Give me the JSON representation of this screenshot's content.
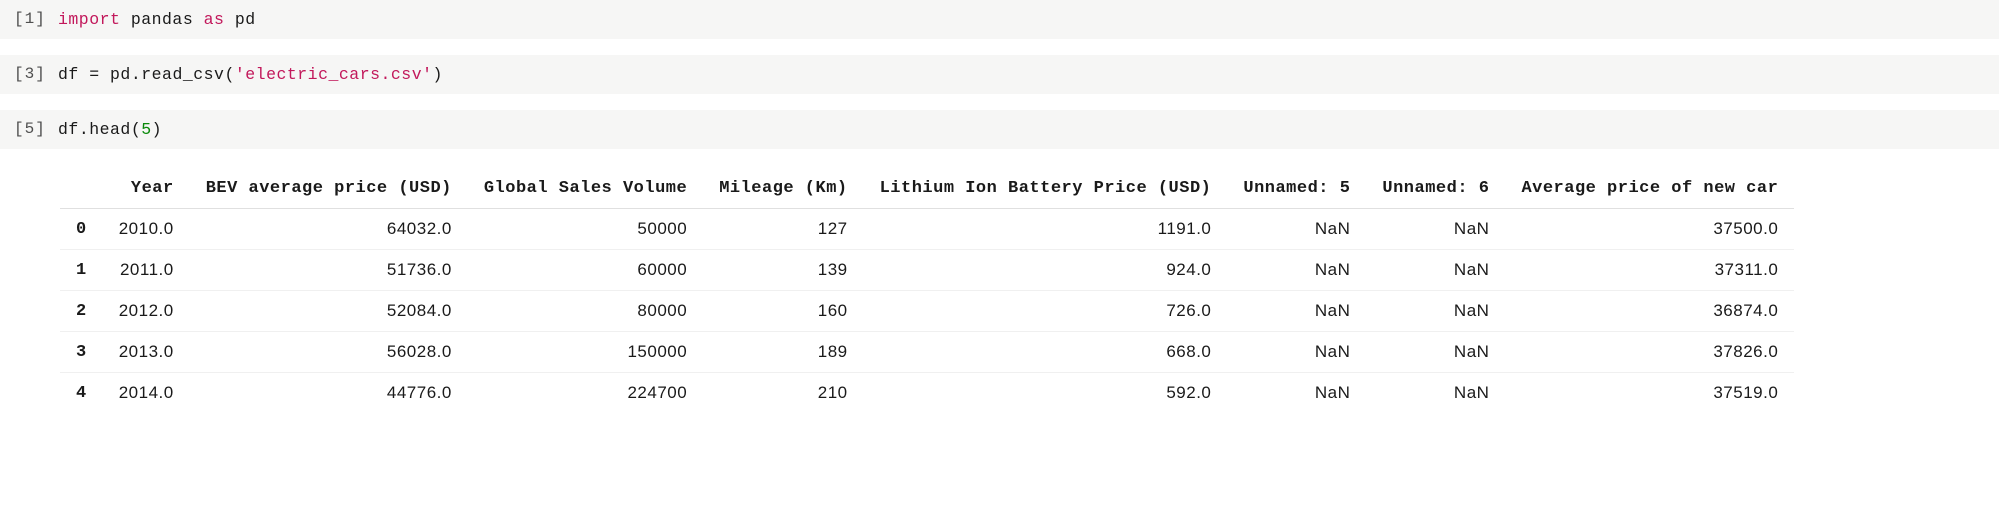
{
  "cells": [
    {
      "prompt": "[1]",
      "code_tokens": [
        {
          "t": "import ",
          "cls": "tok-str"
        },
        {
          "t": "pandas ",
          "cls": "tok-mod"
        },
        {
          "t": "as ",
          "cls": "tok-str"
        },
        {
          "t": "pd",
          "cls": "tok-mod"
        }
      ]
    },
    {
      "prompt": "[3]",
      "code_tokens": [
        {
          "t": "df ",
          "cls": "tok-var"
        },
        {
          "t": "= ",
          "cls": "tok-op"
        },
        {
          "t": "pd",
          "cls": "tok-var"
        },
        {
          "t": ".",
          "cls": "tok-op"
        },
        {
          "t": "read_csv",
          "cls": "tok-func"
        },
        {
          "t": "(",
          "cls": "tok-op"
        },
        {
          "t": "'electric_cars.csv'",
          "cls": "tok-str"
        },
        {
          "t": ")",
          "cls": "tok-op"
        }
      ]
    },
    {
      "prompt": "[5]",
      "code_tokens": [
        {
          "t": "df",
          "cls": "tok-var"
        },
        {
          "t": ".",
          "cls": "tok-op"
        },
        {
          "t": "head",
          "cls": "tok-func"
        },
        {
          "t": "(",
          "cls": "tok-op"
        },
        {
          "t": "5",
          "cls": "tok-num"
        },
        {
          "t": ")",
          "cls": "tok-op"
        }
      ]
    }
  ],
  "dataframe": {
    "columns": [
      "Year",
      "BEV average price (USD)",
      "Global Sales Volume",
      "Mileage (Km)",
      "Lithium Ion Battery Price (USD)",
      "Unnamed: 5",
      "Unnamed: 6",
      "Average price of new car"
    ],
    "index": [
      "0",
      "1",
      "2",
      "3",
      "4"
    ],
    "rows": [
      [
        "2010.0",
        "64032.0",
        "50000",
        "127",
        "1191.0",
        "NaN",
        "NaN",
        "37500.0"
      ],
      [
        "2011.0",
        "51736.0",
        "60000",
        "139",
        "924.0",
        "NaN",
        "NaN",
        "37311.0"
      ],
      [
        "2012.0",
        "52084.0",
        "80000",
        "160",
        "726.0",
        "NaN",
        "NaN",
        "36874.0"
      ],
      [
        "2013.0",
        "56028.0",
        "150000",
        "189",
        "668.0",
        "NaN",
        "NaN",
        "37826.0"
      ],
      [
        "2014.0",
        "44776.0",
        "224700",
        "210",
        "592.0",
        "NaN",
        "NaN",
        "37519.0"
      ]
    ]
  }
}
